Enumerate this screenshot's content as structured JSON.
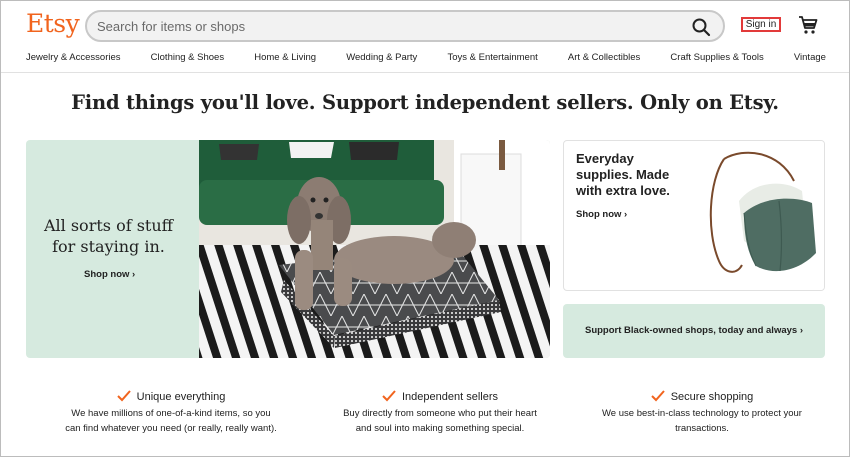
{
  "header": {
    "logo": "Etsy",
    "search_placeholder": "Search for items or shops",
    "search_icon": "search-icon",
    "sign_in": "Sign in",
    "cart_icon": "cart-icon"
  },
  "categories": [
    "Jewelry & Accessories",
    "Clothing & Shoes",
    "Home & Living",
    "Wedding & Party",
    "Toys & Entertainment",
    "Art & Collectibles",
    "Craft Supplies & Tools",
    "Vintage"
  ],
  "tagline": "Find things you'll love. Support independent sellers. Only on Etsy.",
  "hero": {
    "line1": "All sorts of stuff",
    "line2": "for staying in.",
    "shop_now": "Shop now ›"
  },
  "side_card": {
    "line1": "Everyday",
    "line2": "supplies. Made",
    "line3": "with extra love.",
    "shop_now": "Shop now ›"
  },
  "black_owned": "Support Black-owned shops, today and always ›",
  "value_props": [
    {
      "title": "Unique everything",
      "line1": "We have millions of one-of-a-kind items, so you",
      "line2": "can find whatever you need (or really, really want)."
    },
    {
      "title": "Independent sellers",
      "line1": "Buy directly from someone who put their heart",
      "line2": "and soul into making something special."
    },
    {
      "title": "Secure shopping",
      "line1": "We use best-in-class technology to protect your",
      "line2": "transactions."
    }
  ],
  "colors": {
    "brand": "#f1641e",
    "mint": "#d6eadf",
    "signin_border": "#e23a3a"
  }
}
